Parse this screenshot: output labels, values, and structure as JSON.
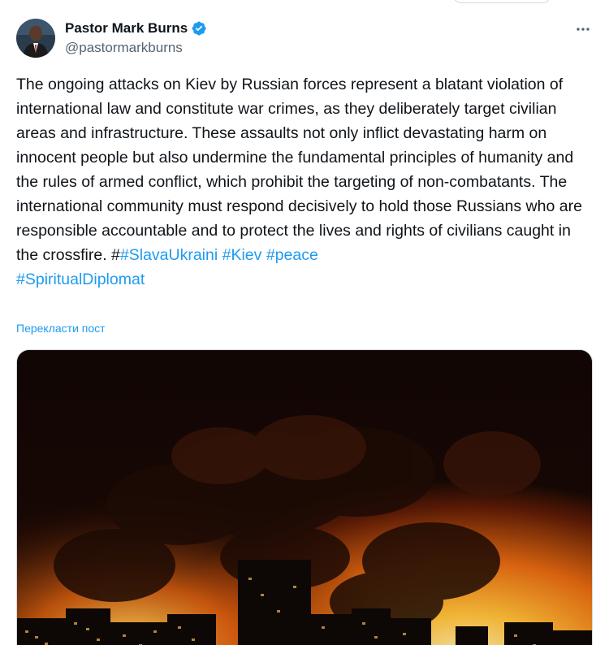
{
  "tweet": {
    "author_name": "Pastor Mark Burns",
    "author_handle": "@pastormarkburns",
    "verified": true,
    "text_before_tags": "The ongoing attacks on Kiev by Russian forces represent a blatant violation of international law and constitute war crimes, as they deliberately target civilian areas and infrastructure. These assaults not only inflict devastating harm on innocent people but also undermine the fundamental principles of humanity and the rules of armed conflict, which prohibit the targeting of non-combatants. The international community must respond decisively to hold those Russians who are responsible accountable and to protect the lives and rights of civilians caught in the crossfire. #",
    "hashtags": [
      "#SlavaUkraini",
      "#Kiev",
      "#peace",
      "#SpiritualDiplomat"
    ],
    "translate_label": "Перекласти пост"
  },
  "icons": {
    "verified": "verified-badge-icon",
    "more": "more-options-icon"
  },
  "colors": {
    "link": "#1d9bf0",
    "text": "#0f1419",
    "secondary": "#536471",
    "border": "#cfd9de"
  }
}
